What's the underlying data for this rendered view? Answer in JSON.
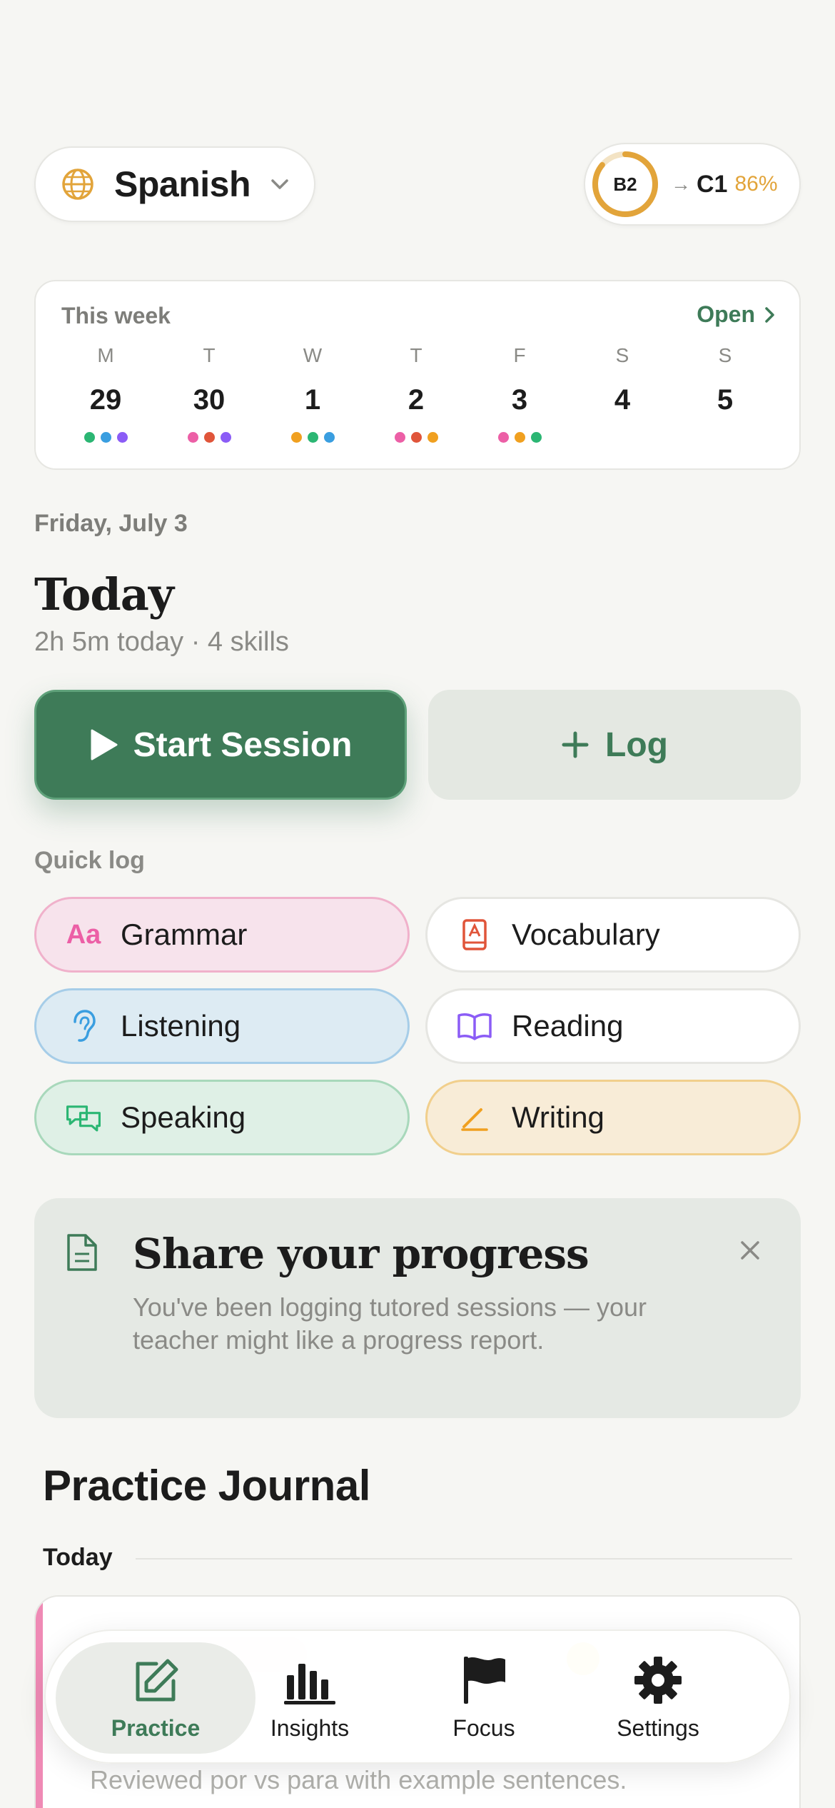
{
  "header": {
    "language": "Spanish",
    "current_level": "B2",
    "target_level": "C1",
    "arrow": "→",
    "progress_pct": "86%",
    "progress_value": 0.86
  },
  "week": {
    "title": "This week",
    "open_label": "Open",
    "days": [
      {
        "letter": "M",
        "num": "29",
        "dots": [
          "#2bb673",
          "#3a9ee0",
          "#8b5cf6"
        ]
      },
      {
        "letter": "T",
        "num": "30",
        "dots": [
          "#ec5fa6",
          "#e0553a",
          "#8b5cf6"
        ]
      },
      {
        "letter": "W",
        "num": "1",
        "dots": [
          "#f0a020",
          "#2bb673",
          "#3a9ee0"
        ]
      },
      {
        "letter": "T",
        "num": "2",
        "dots": [
          "#ec5fa6",
          "#e0553a",
          "#f0a020"
        ]
      },
      {
        "letter": "F",
        "num": "3",
        "dots": [
          "#ec5fa6",
          "#f0a020",
          "#2bb673"
        ]
      },
      {
        "letter": "S",
        "num": "4",
        "dots": []
      },
      {
        "letter": "S",
        "num": "5",
        "dots": []
      }
    ]
  },
  "today": {
    "date": "Friday, July 3",
    "title": "Today",
    "subtitle": "2h 5m today · 4 skills"
  },
  "actions": {
    "start_label": "Start Session",
    "log_label": "Log"
  },
  "quick_log": {
    "label": "Quick log",
    "grammar_icon_text": "Aa",
    "items": {
      "grammar": "Grammar",
      "vocabulary": "Vocabulary",
      "listening": "Listening",
      "reading": "Reading",
      "speaking": "Speaking",
      "writing": "Writing"
    }
  },
  "share": {
    "title": "Share your progress",
    "body": "You've been logging tutored sessions — your teacher might like a progress report."
  },
  "journal": {
    "title": "Practice Journal",
    "section": "Today",
    "entry_note": "Reviewed por vs para with example sentences."
  },
  "tabs": [
    {
      "label": "Practice",
      "icon": "edit-square-icon"
    },
    {
      "label": "Insights",
      "icon": "bar-chart-icon"
    },
    {
      "label": "Focus",
      "icon": "flag-icon"
    },
    {
      "label": "Settings",
      "icon": "gear-icon"
    }
  ],
  "colors": {
    "accent": "#3e7b58",
    "level_ring": "#e2a43a",
    "grammar": "#ec5fa6",
    "vocabulary": "#e0553a",
    "listening": "#3a9ee0",
    "reading": "#8b5cf6",
    "speaking": "#2bb673",
    "writing": "#f0a020"
  }
}
